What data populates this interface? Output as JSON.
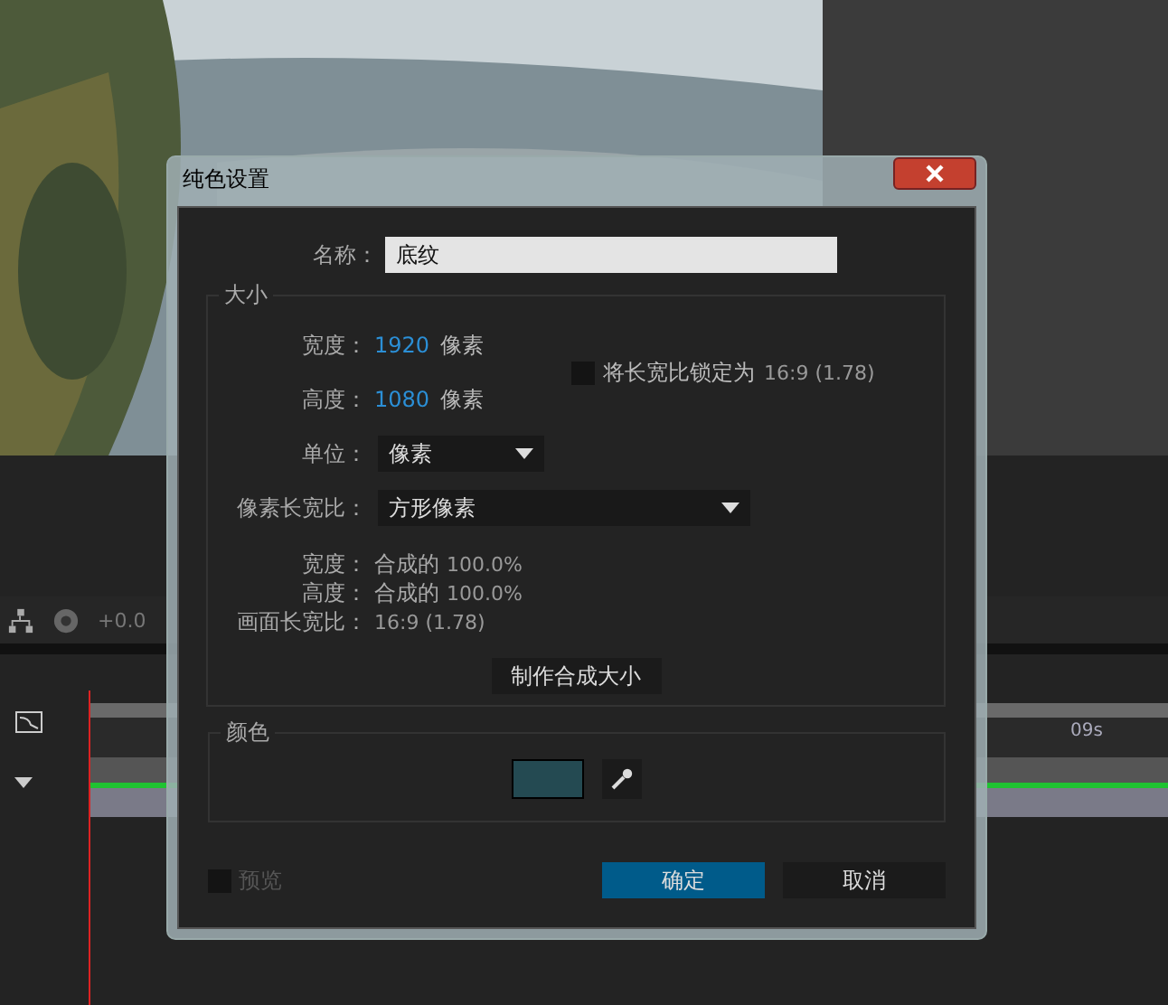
{
  "window": {
    "title": "纯色设置"
  },
  "name": {
    "label": "名称：",
    "value": "底纹"
  },
  "size": {
    "legend": "大小",
    "dims": [
      {
        "label": "宽度：",
        "value": "1920",
        "unit": "像素"
      },
      {
        "label": "高度：",
        "value": "1080",
        "unit": "像素"
      }
    ],
    "lock": {
      "label": "将长宽比锁定为",
      "ratio": "16:9 (1.78)",
      "checked": false
    },
    "units": {
      "label": "单位：",
      "value": "像素"
    },
    "pixel_aspect": {
      "label": "像素长宽比：",
      "value": "方形像素"
    },
    "info": [
      {
        "label": "宽度：",
        "prefix": "合成的",
        "value": "100.0%"
      },
      {
        "label": "高度：",
        "prefix": "合成的",
        "value": "100.0%"
      },
      {
        "label": "画面长宽比：",
        "value": "16:9 (1.78)"
      }
    ],
    "button": "制作合成大小"
  },
  "color": {
    "legend": "颜色",
    "swatch": {
      "color": "#244a52"
    }
  },
  "preview": {
    "label": "预览",
    "checked": false
  },
  "buttons": [
    {
      "label": "确定",
      "primary": true
    },
    {
      "label": "取消",
      "primary": false
    }
  ],
  "background": {
    "exposure": "+0.0",
    "time_label": "09s"
  }
}
